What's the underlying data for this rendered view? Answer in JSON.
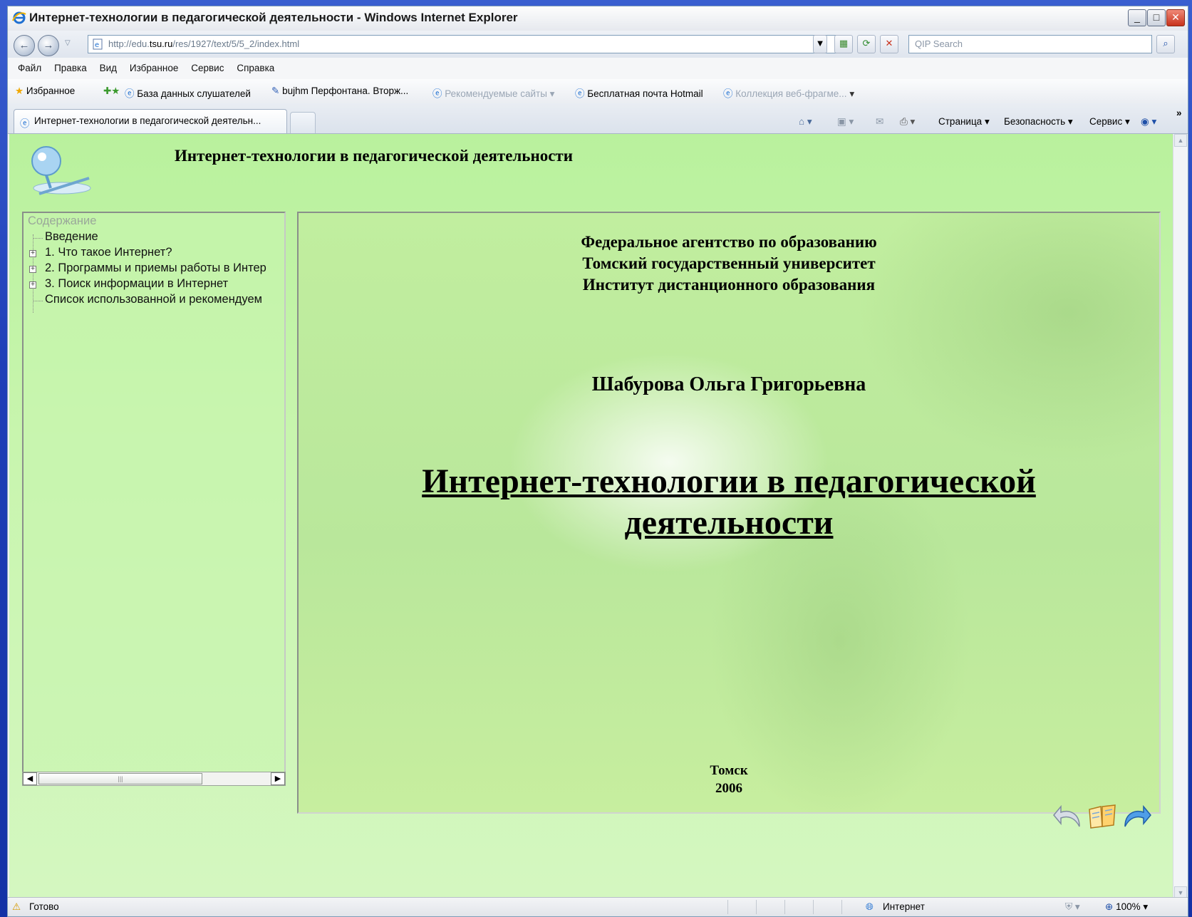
{
  "window": {
    "title": "Интернет-технологии в педагогической деятельности - Windows Internet Explorer"
  },
  "address": {
    "url_prefix": "http://edu.",
    "url_domain": "tsu.ru",
    "url_path": "/res/1927/text/5/5_2/index.html",
    "search_placeholder": "QIP Search"
  },
  "menu": [
    "Файл",
    "Правка",
    "Вид",
    "Избранное",
    "Сервис",
    "Справка"
  ],
  "favorites": {
    "label": "Избранное",
    "items": [
      "База данных слушателей",
      "bujhm Перфонтана. Вторж...",
      "Рекомендуемые сайты",
      "Бесплатная почта Hotmail",
      "Коллекция веб-фрагме..."
    ]
  },
  "tab": {
    "label": "Интернет-технологии в педагогической деятельн..."
  },
  "commandbar": {
    "page": "Страница",
    "safety": "Безопасность",
    "tools": "Сервис"
  },
  "page": {
    "site_title": "Интернет-технологии в педагогической деятельности",
    "toc": {
      "header": "Содержание",
      "items": [
        "Введение",
        "1. Что такое Интернет?",
        "2. Программы и приемы работы в Интер",
        "3. Поиск информации в Интернет",
        "Список использованной и рекомендуем"
      ]
    },
    "doc": {
      "org_line1": "Федеральное агентство по образованию",
      "org_line2": "Томский государственный университет",
      "org_line3": "Институт дистанционного образования",
      "author": "Шабурова Ольга Григорьевна",
      "title_line1": "Интернет-технологии в педагогической",
      "title_line2": "деятельности",
      "city": "Томск",
      "year": "2006"
    }
  },
  "status": {
    "left": "Готово",
    "zone": "Интернет",
    "zoom": "100%"
  },
  "colors": {
    "page_bg": "#c8f5ae",
    "title_bar": "#e6e9ee",
    "frame": "#1f3fb8"
  }
}
